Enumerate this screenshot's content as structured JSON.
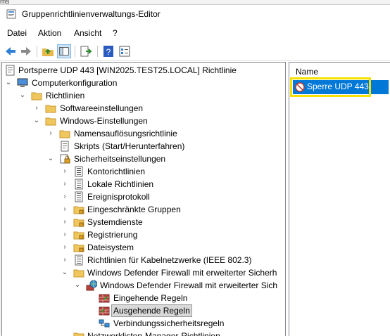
{
  "window": {
    "top_fragment": "ms",
    "title": "Gruppenrichtlinienverwaltungs-Editor"
  },
  "menu": {
    "items": [
      "Datei",
      "Aktion",
      "Ansicht",
      "?"
    ]
  },
  "toolbar": {
    "buttons": [
      "back-arrow-icon",
      "forward-arrow-icon",
      "up-folder-icon",
      "show-hide-tree-icon",
      "export-list-icon",
      "help-icon",
      "properties-icon"
    ]
  },
  "tree": {
    "root": "Portsperre UDP 443 [WIN2025.TEST25.LOCAL] Richtlinie",
    "computer_config": "Computerkonfiguration",
    "policies": "Richtlinien",
    "software_settings": "Softwareeinstellungen",
    "windows_settings": "Windows-Einstellungen",
    "name_resolution": "Namensauflösungsrichtlinie",
    "scripts": "Skripts (Start/Herunterfahren)",
    "security_settings": "Sicherheitseinstellungen",
    "account_policies": "Kontorichtlinien",
    "local_policies": "Lokale Richtlinien",
    "event_log": "Ereignisprotokoll",
    "restricted_groups": "Eingeschränkte Gruppen",
    "system_services": "Systemdienste",
    "registry": "Registrierung",
    "file_system": "Dateisystem",
    "wired_network": "Richtlinien für Kabelnetzwerke (IEEE 802.3)",
    "wdf_folder": "Windows Defender Firewall mit erweiterter Sicherh",
    "wdf_node": "Windows Defender Firewall mit erweiterter Sich",
    "inbound_rules": "Eingehende Regeln",
    "outbound_rules": "Ausgehende Regeln",
    "connection_rules": "Verbindungssicherheitsregeln",
    "cut_item": "Netzwerklisten-Manager-Richtlinien"
  },
  "list": {
    "column_name": "Name",
    "rows": [
      "Sperre UDP 443"
    ]
  },
  "colors": {
    "selection": "#0078d7",
    "highlight_box": "#f5e100",
    "folder": "#f0c75e"
  }
}
